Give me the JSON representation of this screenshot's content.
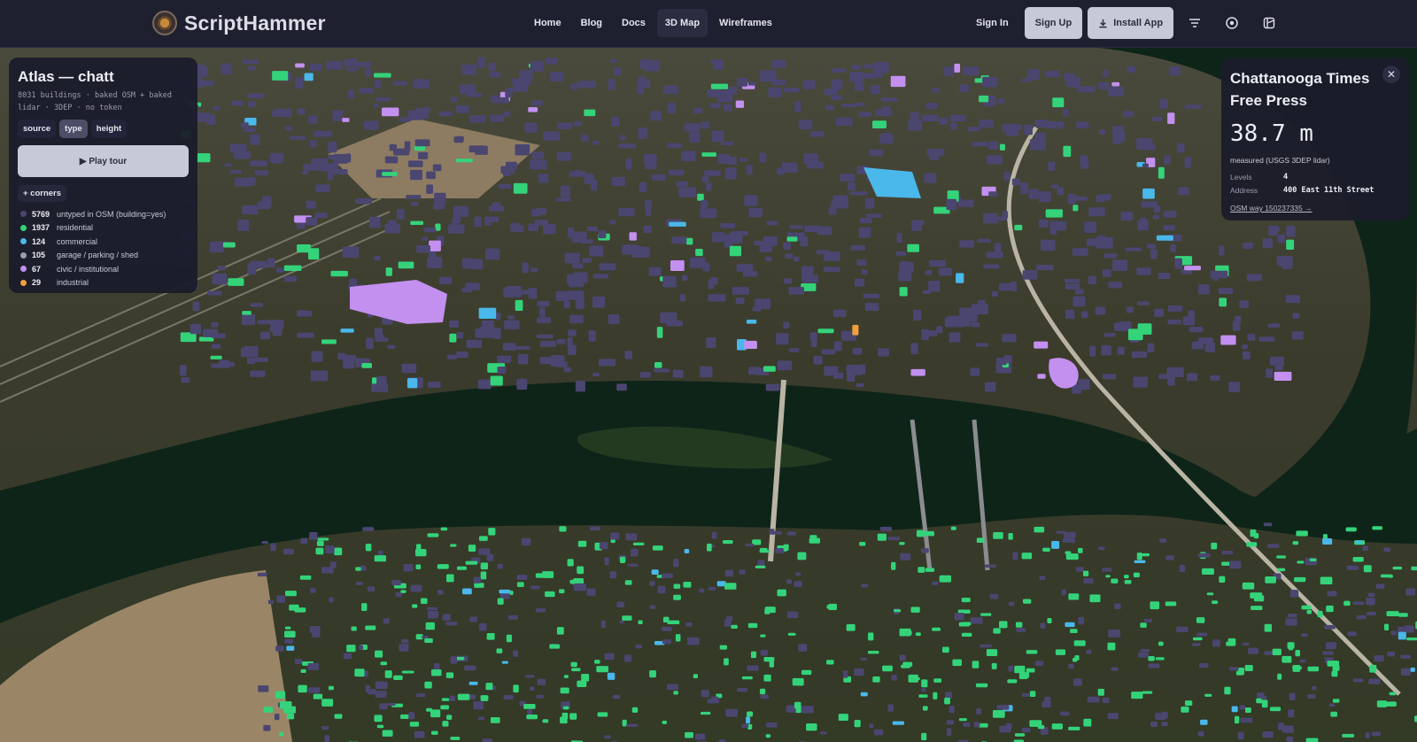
{
  "nav": {
    "brand": "ScriptHammer",
    "links": [
      {
        "label": "Home"
      },
      {
        "label": "Blog"
      },
      {
        "label": "Docs"
      },
      {
        "label": "3D Map",
        "active": true
      },
      {
        "label": "Wireframes"
      }
    ],
    "sign_in": "Sign In",
    "sign_up": "Sign Up",
    "install": "Install App",
    "icons": [
      "menu-lines-icon",
      "eye-icon",
      "theme-palette-icon"
    ]
  },
  "atlas": {
    "title": "Atlas — chatt",
    "subtitle": "8031 buildings · baked OSM + baked lidar · 3DEP · no token",
    "modes": [
      "source",
      "type",
      "height"
    ],
    "active_mode": "type",
    "tour_label": "▶ Play tour",
    "corners_label": "+ corners",
    "legend": [
      {
        "count": "5769",
        "label": "untyped in OSM (building=yes)",
        "color": "#4a4670"
      },
      {
        "count": "1937",
        "label": "residential",
        "color": "#34d37a"
      },
      {
        "count": "124",
        "label": "commercial",
        "color": "#4ab8ea"
      },
      {
        "count": "105",
        "label": "garage / parking / shed",
        "color": "#9a9cb0"
      },
      {
        "count": "67",
        "label": "civic / institutional",
        "color": "#c390f0"
      },
      {
        "count": "29",
        "label": "industrial",
        "color": "#f0a040"
      }
    ]
  },
  "card": {
    "title": "Chattanooga Times Free Press",
    "close": "✕",
    "height": "38.7 m",
    "measured": "measured (USGS 3DEP lidar)",
    "levels_label": "Levels",
    "levels_value": "4",
    "address_label": "Address",
    "address_value": "400 East 11th Street",
    "link": "OSM way 150237335 →"
  },
  "colors": {
    "untyped": "#4a4670",
    "residential": "#34d37a",
    "commercial": "#4ab8ea",
    "civic": "#c390f0",
    "industrial": "#f0a040",
    "river": "#0e2419",
    "terrain": "#3c3a2c"
  }
}
